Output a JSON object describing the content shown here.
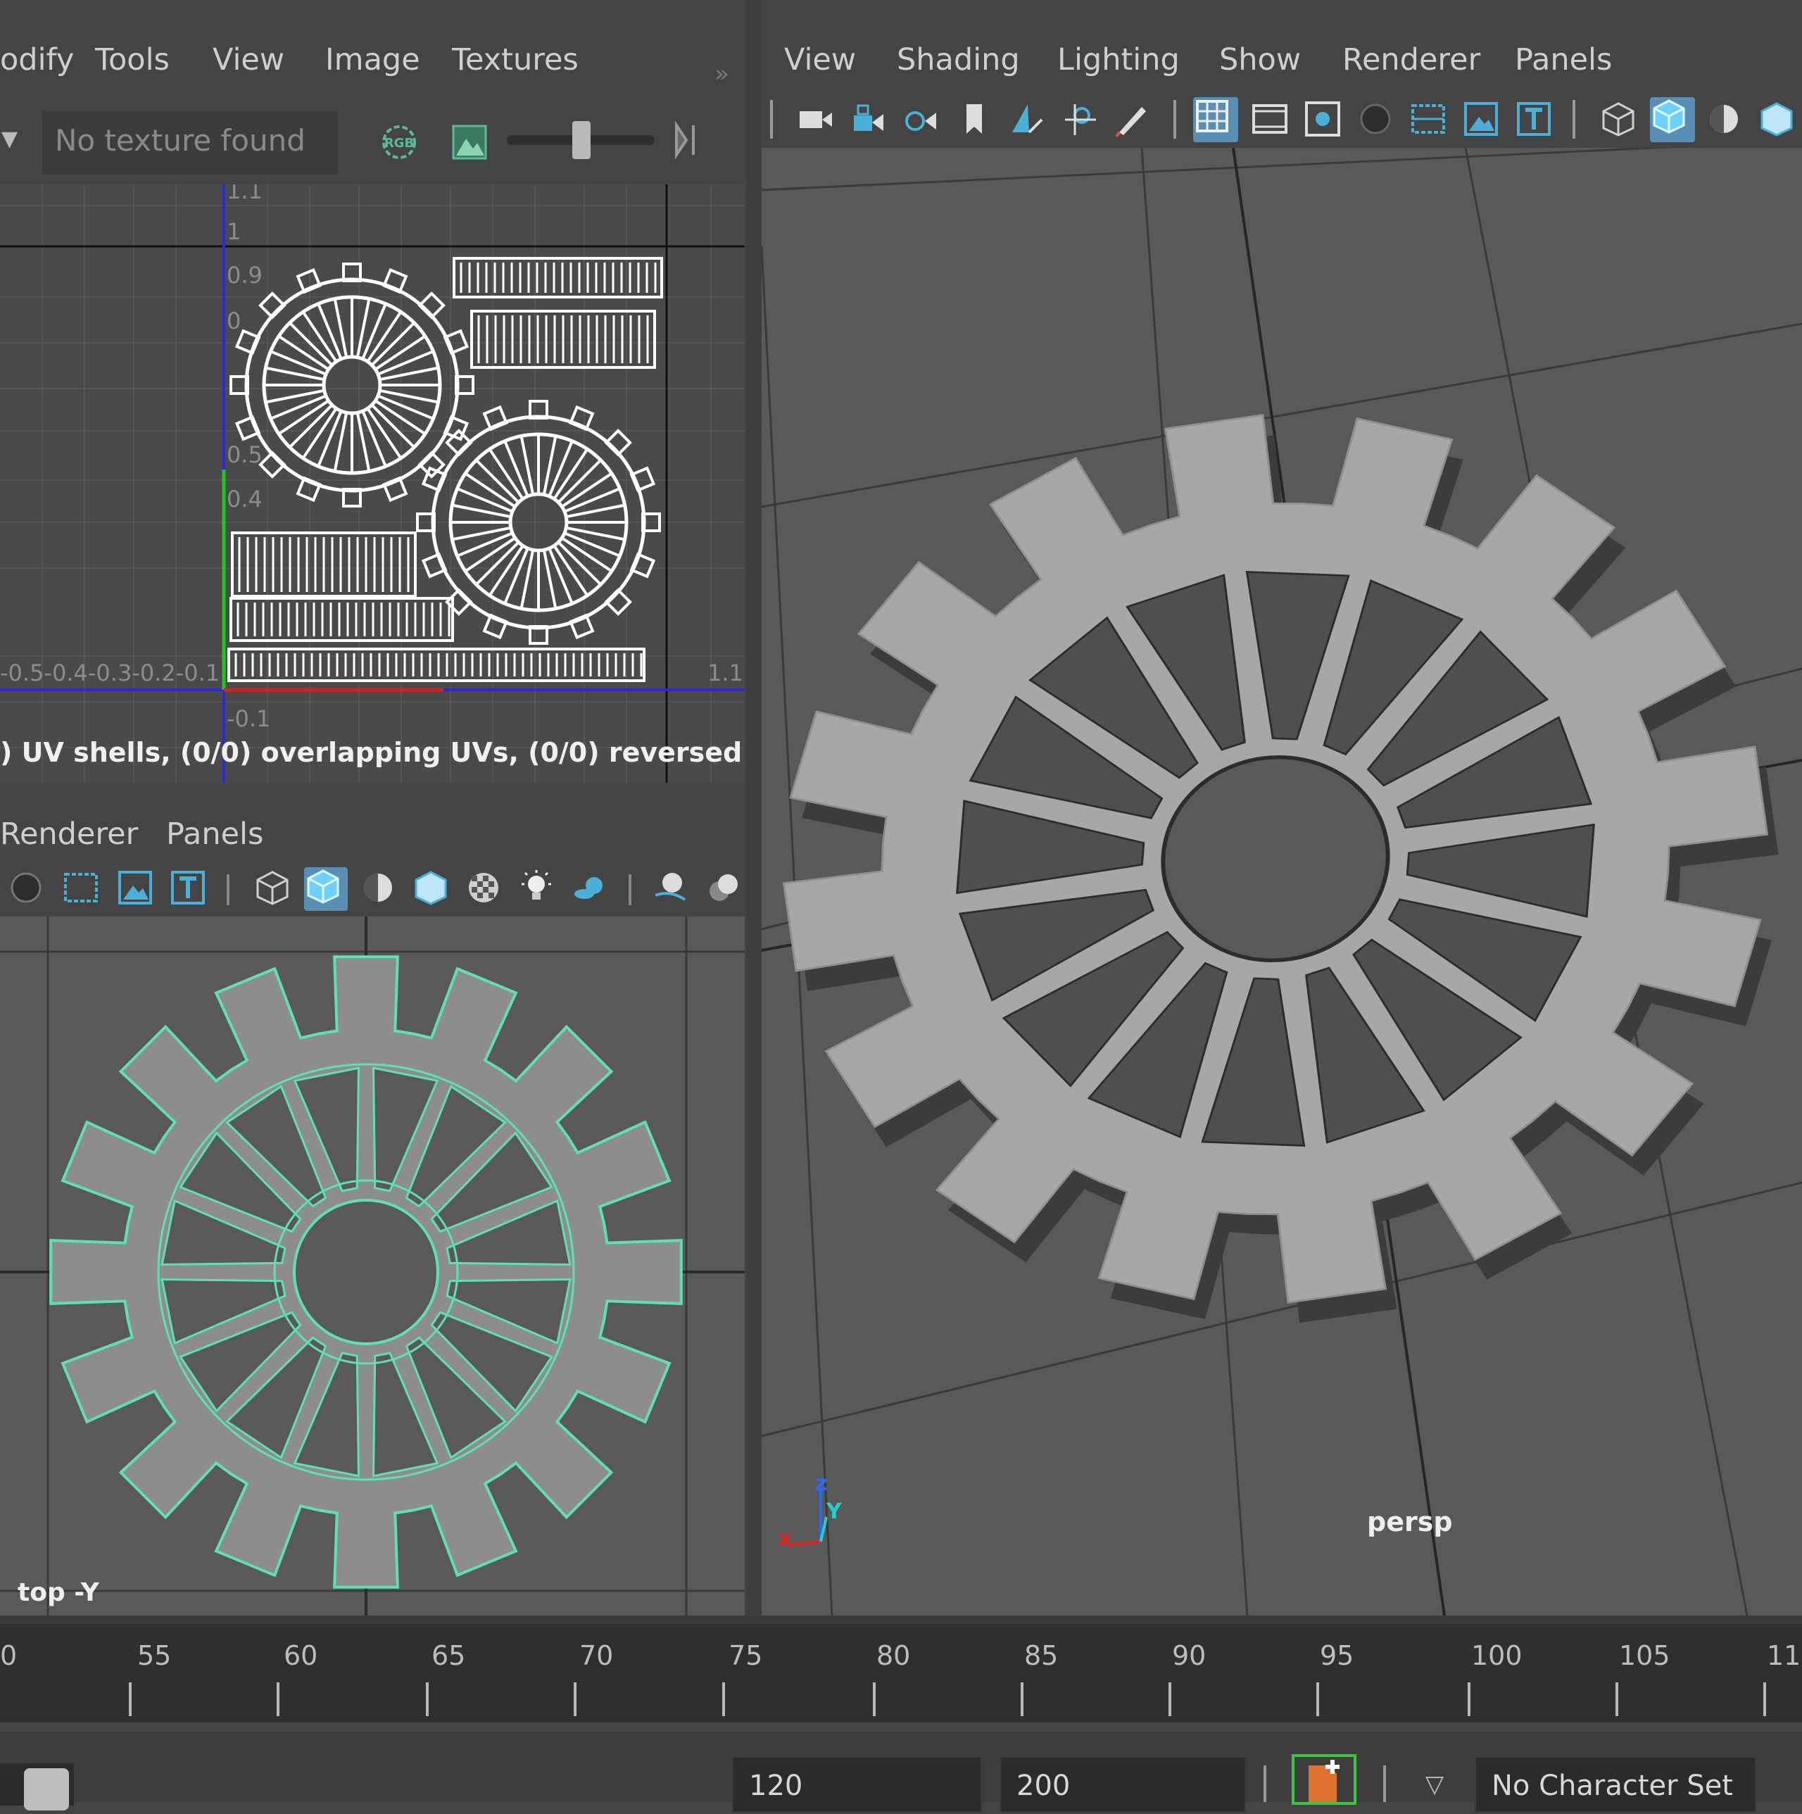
{
  "uv_editor": {
    "menu": [
      "odify",
      "Tools",
      "View",
      "Image",
      "Textures"
    ],
    "texture_dropdown": "No texture found",
    "rgb_label": "RGB",
    "ticks_y": [
      "1.1",
      "1",
      "0.9",
      "0",
      "0.5",
      "0.4",
      "-0.1"
    ],
    "ticks_x": "-0.5-0.4-0.3-0.2-0.1",
    "tick_x_right": "1.1",
    "status": ") UV shells, (0/0) overlapping UVs, (0/0) reversed UVs"
  },
  "bottom_left_panel": {
    "menu": [
      "Renderer",
      "Panels"
    ],
    "camera_label": "top -Y"
  },
  "persp_panel": {
    "menu": [
      "View",
      "Shading",
      "Lighting",
      "Show",
      "Renderer",
      "Panels"
    ],
    "camera_label": "persp",
    "axis": {
      "x": "x",
      "y": "Y",
      "z": "z"
    }
  },
  "timeline": {
    "labels": [
      "0",
      "55",
      "60",
      "65",
      "70",
      "75",
      "80",
      "85",
      "90",
      "95",
      "100",
      "105",
      "11"
    ]
  },
  "range_bar": {
    "end_time": "120",
    "playback_end": "200",
    "character_set": "No Character Set"
  },
  "colors": {
    "accent": "#5a8fb5",
    "wire": "#5fe0b0",
    "model": "#a7a7a7"
  }
}
